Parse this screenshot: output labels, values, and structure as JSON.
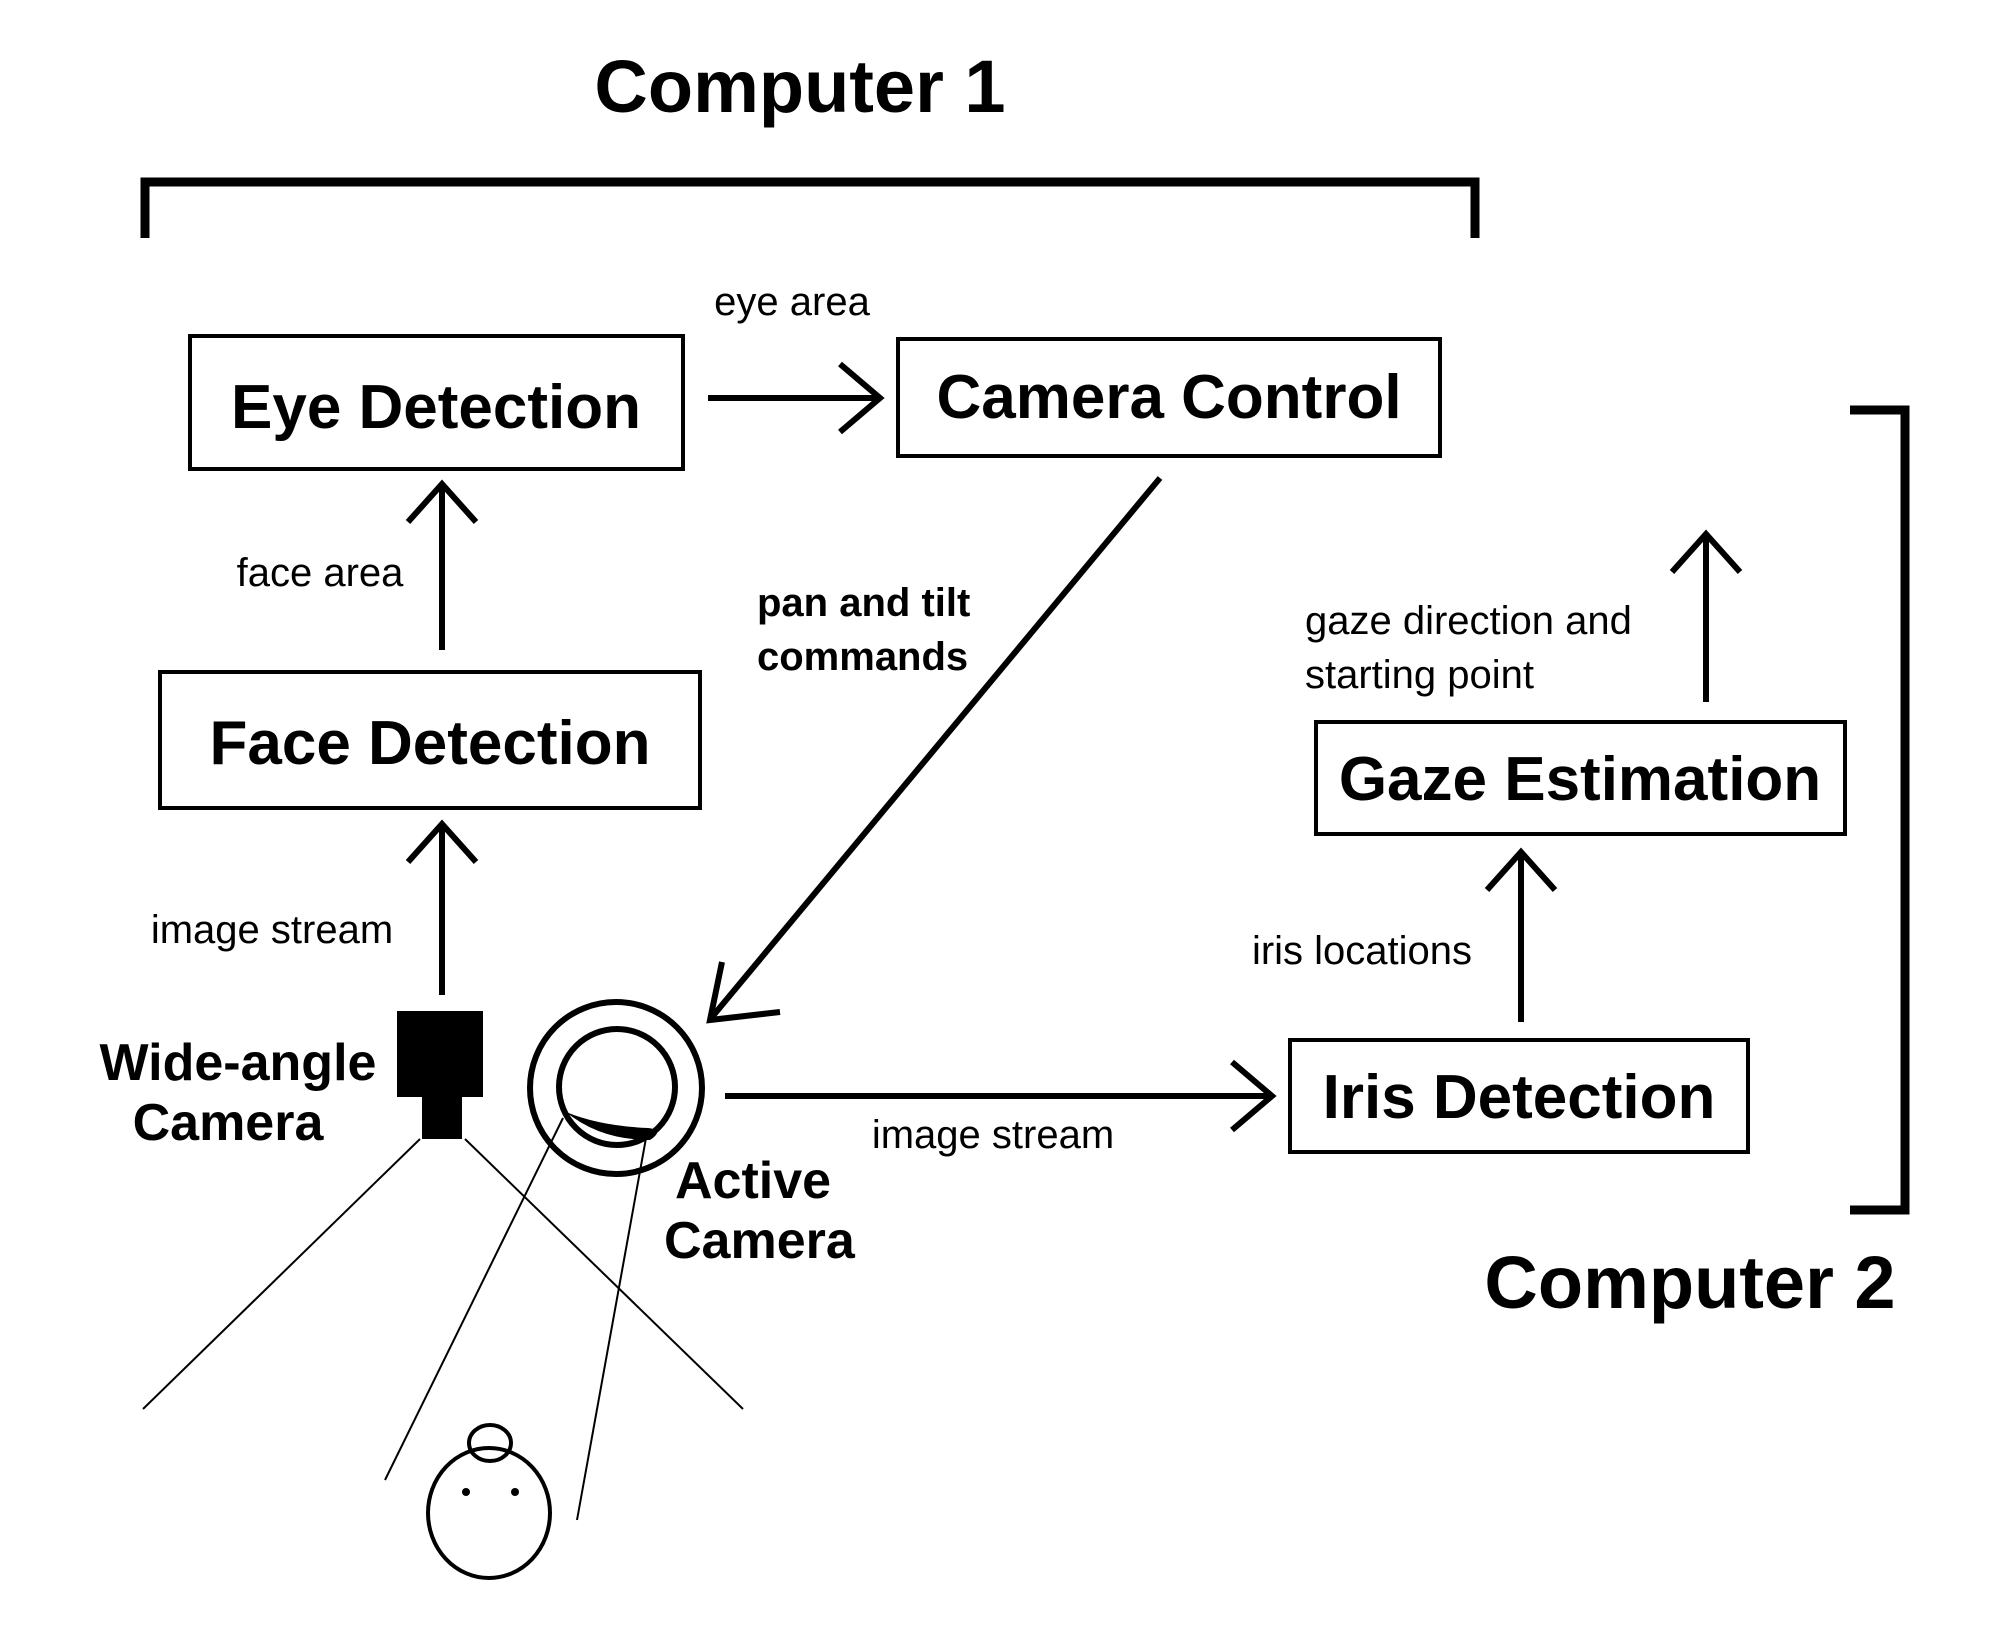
{
  "groups": {
    "computer1": {
      "title": "Computer 1"
    },
    "computer2": {
      "title": "Computer 2"
    }
  },
  "nodes": {
    "eye_detection": {
      "label": "Eye Detection"
    },
    "camera_control": {
      "label": "Camera Control"
    },
    "face_detection": {
      "label": "Face Detection"
    },
    "gaze_estimation": {
      "label": "Gaze Estimation"
    },
    "iris_detection": {
      "label": "Iris Detection"
    }
  },
  "cameras": {
    "wide_angle": {
      "line1": "Wide-angle",
      "line2": "Camera"
    },
    "active": {
      "line1": "Active",
      "line2": "Camera"
    }
  },
  "edges": {
    "eye_to_camera_control": {
      "label": "eye area"
    },
    "face_to_eye": {
      "label": "face area"
    },
    "wide_to_face": {
      "label": "image stream"
    },
    "control_to_active": {
      "line1": "pan and tilt",
      "line2": "commands"
    },
    "active_to_iris": {
      "label": "image stream"
    },
    "iris_to_gaze": {
      "label": "iris locations"
    },
    "gaze_output": {
      "line1": "gaze direction and",
      "line2": "starting point"
    }
  }
}
